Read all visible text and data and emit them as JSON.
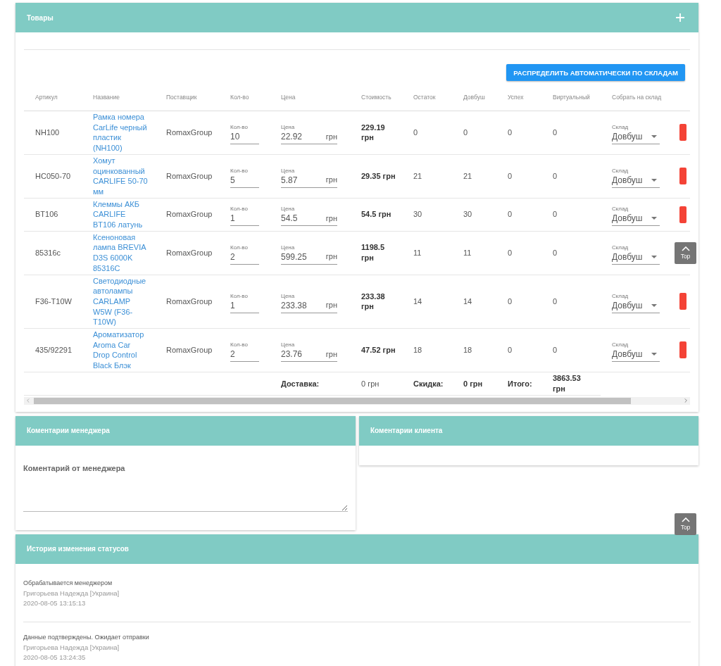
{
  "products": {
    "title": "Товары",
    "distribute_button": "РАСПРЕДЕЛИТЬ АВТОМАТИЧЕСКИ ПО СКЛАДАМ",
    "columns": [
      "Артикул",
      "Название",
      "Поставщик",
      "Кол-во",
      "Цена",
      "Стоимость",
      "Остаток",
      "Довбуш",
      "Успех",
      "Виртуальный",
      "Собрать на склад"
    ],
    "rows": [
      {
        "sku": "NH100",
        "name": "Рамка номера CarLife черный пластик (NH100)",
        "supplier": "RomaxGroup",
        "qty_label": "Кол-во",
        "qty": "10",
        "price_label": "Цена",
        "price": "22.92",
        "price_unit": "грн",
        "cost": "229.19 грн",
        "stock": "0",
        "dovbush": "0",
        "uspeh": "0",
        "virtual": "0",
        "warehouse_label": "Склад",
        "warehouse": "Довбуш"
      },
      {
        "sku": "HC050-70",
        "name": "Хомут оцинкованный CARLIFE 50-70 мм",
        "supplier": "RomaxGroup",
        "qty_label": "Кол-во",
        "qty": "5",
        "price_label": "Цена",
        "price": "5.87",
        "price_unit": "грн",
        "cost": "29.35 грн",
        "stock": "21",
        "dovbush": "21",
        "uspeh": "0",
        "virtual": "0",
        "warehouse_label": "Склад",
        "warehouse": "Довбуш"
      },
      {
        "sku": "BT106",
        "name": "Клеммы АКБ CARLIFE BT106 латунь",
        "supplier": "RomaxGroup",
        "qty_label": "Кол-во",
        "qty": "1",
        "price_label": "Цена",
        "price": "54.5",
        "price_unit": "грн",
        "cost": "54.5 грн",
        "stock": "30",
        "dovbush": "30",
        "uspeh": "0",
        "virtual": "0",
        "warehouse_label": "Склад",
        "warehouse": "Довбуш"
      },
      {
        "sku": "85316c",
        "name": "Ксеноновая лампа BREVIA D3S 6000K 85316C",
        "supplier": "RomaxGroup",
        "qty_label": "Кол-во",
        "qty": "2",
        "price_label": "Цена",
        "price": "599.25",
        "price_unit": "грн",
        "cost": "1198.5 грн",
        "stock": "11",
        "dovbush": "11",
        "uspeh": "0",
        "virtual": "0",
        "warehouse_label": "Склад",
        "warehouse": "Довбуш"
      },
      {
        "sku": "F36-T10W",
        "name": "Светодиодные автолампы CARLAMP W5W (F36-T10W)",
        "supplier": "RomaxGroup",
        "qty_label": "Кол-во",
        "qty": "1",
        "price_label": "Цена",
        "price": "233.38",
        "price_unit": "грн",
        "cost": "233.38 грн",
        "stock": "14",
        "dovbush": "14",
        "uspeh": "0",
        "virtual": "0",
        "warehouse_label": "Склад",
        "warehouse": "Довбуш"
      },
      {
        "sku": "435/92291",
        "name": "Ароматизатор Aroma Car Drop Control Black Блэк",
        "supplier": "RomaxGroup",
        "qty_label": "Кол-во",
        "qty": "2",
        "price_label": "Цена",
        "price": "23.76",
        "price_unit": "грн",
        "cost": "47.52 грн",
        "stock": "18",
        "dovbush": "18",
        "uspeh": "0",
        "virtual": "0",
        "warehouse_label": "Склад",
        "warehouse": "Довбуш"
      }
    ],
    "footer": {
      "delivery_label": "Доставка:",
      "delivery": "0 грн",
      "discount_label": "Скидка:",
      "discount": "0 грн",
      "total_label": "Итого:",
      "total": "3863.53 грн"
    }
  },
  "manager_comments": {
    "title": "Коментарии менеджера",
    "placeholder": "Коментарий от менеджера"
  },
  "client_comments": {
    "title": "Коментарии клиента"
  },
  "status_history": {
    "title": "История изменения статусов",
    "entries": [
      {
        "status": "Обрабатывается менеджером",
        "user": "Григорьева Надежда [Украина]",
        "time": "2020-08-05 13:15:13"
      },
      {
        "status": "Данные подтверждены. Ожидает отправки",
        "user": "Григорьева Надежда [Украина]",
        "time": "2020-08-05 13:24:35"
      }
    ]
  },
  "top_buttons": [
    "Top",
    "Top"
  ]
}
